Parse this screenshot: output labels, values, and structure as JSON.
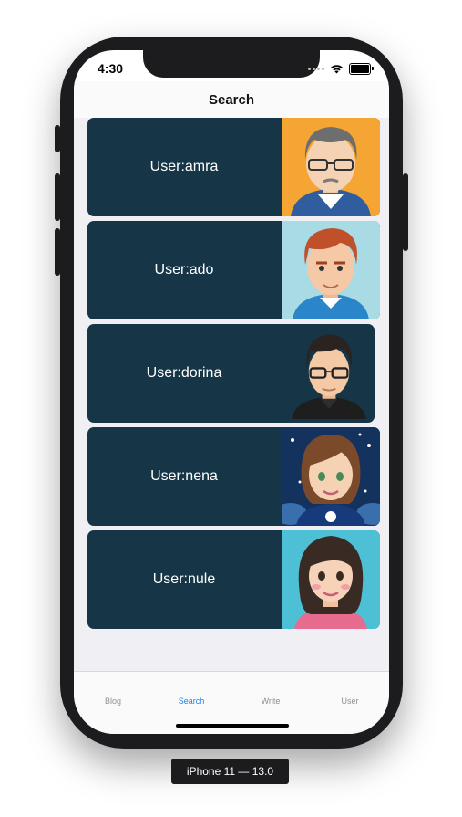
{
  "status_bar": {
    "time": "4:30"
  },
  "nav": {
    "title": "Search"
  },
  "users": [
    {
      "label": "User:amra",
      "avatar": "avatar-man-gray-hair-glasses",
      "bg": "#f4a534"
    },
    {
      "label": "User:ado",
      "avatar": "avatar-man-red-hair",
      "bg": "#a9dbe4"
    },
    {
      "label": "User:dorina",
      "avatar": "avatar-man-dark-hair-glasses",
      "bg": "#163547"
    },
    {
      "label": "User:nena",
      "avatar": "avatar-woman-brown-hair-stars",
      "bg": "#14325e"
    },
    {
      "label": "User:nule",
      "avatar": "avatar-woman-dark-hair",
      "bg": "#4ec0d6"
    }
  ],
  "tabs": [
    {
      "label": "Blog",
      "active": false
    },
    {
      "label": "Search",
      "active": true
    },
    {
      "label": "Write",
      "active": false
    },
    {
      "label": "User",
      "active": false
    }
  ],
  "device_label": "iPhone 11 — 13.0",
  "colors": {
    "card": "#163547",
    "tab_active": "#1a82e5",
    "tab_inactive": "#8e8e93"
  }
}
